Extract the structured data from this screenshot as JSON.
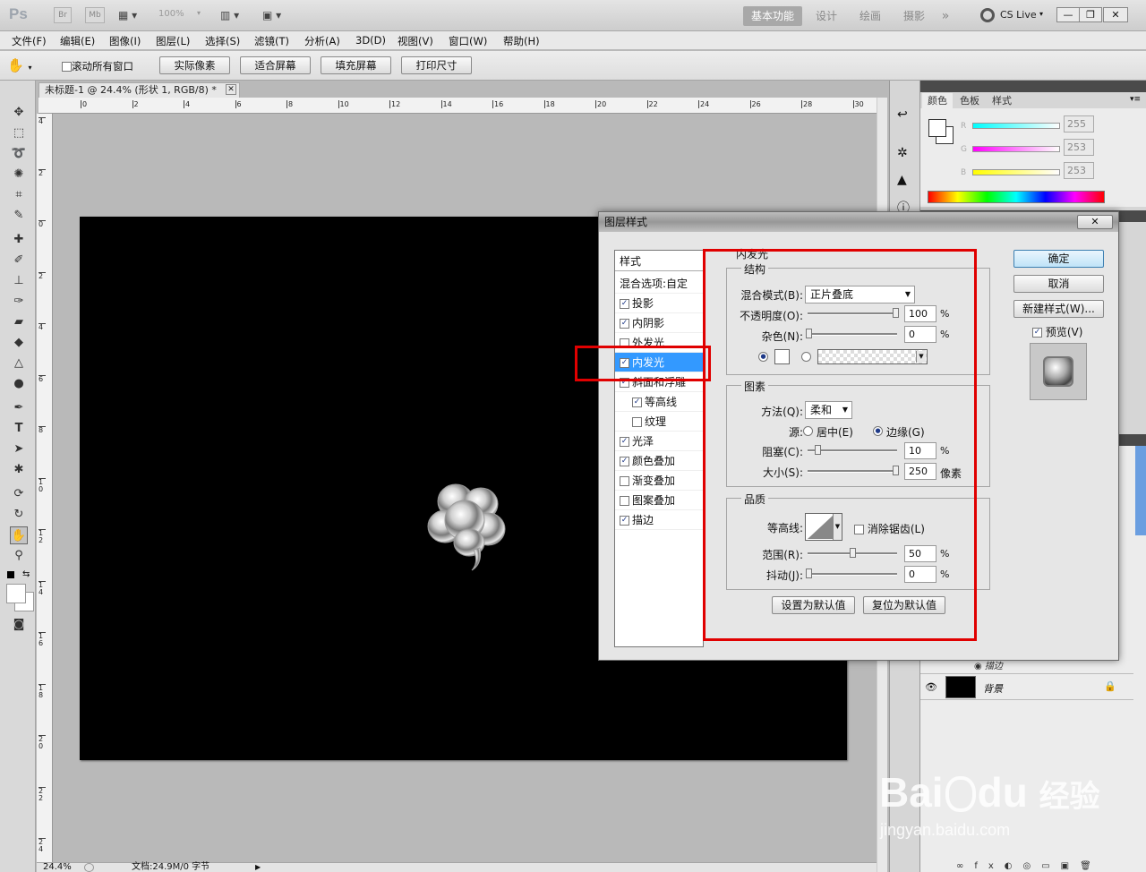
{
  "app": {
    "logo": "Ps",
    "bridge_btn": "Br",
    "minibridge_btn": "Mb",
    "zoom_field": "100%",
    "workspaces": [
      "基本功能",
      "设计",
      "绘画",
      "摄影"
    ],
    "more": "»",
    "cslive": "CS Live"
  },
  "menu": [
    "文件(F)",
    "编辑(E)",
    "图像(I)",
    "图层(L)",
    "选择(S)",
    "滤镜(T)",
    "分析(A)",
    "3D(D)",
    "视图(V)",
    "窗口(W)",
    "帮助(H)"
  ],
  "options": {
    "scroll_all_label": "滚动所有窗口",
    "buttons": [
      "实际像素",
      "适合屏幕",
      "填充屏幕",
      "打印尺寸"
    ]
  },
  "document": {
    "tab_title": "未标题-1 @ 24.4% (形状 1, RGB/8) *",
    "ruler_top": [
      "0",
      "2",
      "4",
      "6",
      "8",
      "10",
      "12",
      "14",
      "16",
      "18",
      "20",
      "22",
      "24",
      "26",
      "28",
      "30"
    ],
    "ruler_left": [
      "4",
      "2",
      "0",
      "2",
      "4",
      "6",
      "8",
      "1 0",
      "1 2",
      "1 4",
      "1 6",
      "1 8",
      "2 0",
      "2 2",
      "2 4"
    ],
    "zoom": "24.4%",
    "doc_info": "文档:24.9M/0 字节"
  },
  "color_panel": {
    "tabs": [
      "颜色",
      "色板",
      "样式"
    ],
    "r_label": "R",
    "g_label": "G",
    "b_label": "B",
    "r": "255",
    "g": "253",
    "b": "253"
  },
  "layers_panel": {
    "effect_label": "描边",
    "bg_layer": "背景"
  },
  "dialog": {
    "title": "图层样式",
    "close": "✕",
    "list_header": "样式",
    "blend_options": "混合选项:自定",
    "items": [
      {
        "label": "投影",
        "checked": true,
        "sub": false
      },
      {
        "label": "内阴影",
        "checked": true,
        "sub": false
      },
      {
        "label": "外发光",
        "checked": false,
        "sub": false
      },
      {
        "label": "内发光",
        "checked": true,
        "sub": false,
        "selected": true
      },
      {
        "label": "斜面和浮雕",
        "checked": true,
        "sub": false
      },
      {
        "label": "等高线",
        "checked": true,
        "sub": true
      },
      {
        "label": "纹理",
        "checked": false,
        "sub": true
      },
      {
        "label": "光泽",
        "checked": true,
        "sub": false
      },
      {
        "label": "颜色叠加",
        "checked": true,
        "sub": false
      },
      {
        "label": "渐变叠加",
        "checked": false,
        "sub": false
      },
      {
        "label": "图案叠加",
        "checked": false,
        "sub": false
      },
      {
        "label": "描边",
        "checked": true,
        "sub": false
      }
    ],
    "section_title": "内发光",
    "structure": {
      "title": "结构",
      "blend_mode_label": "混合模式(B):",
      "blend_mode": "正片叠底",
      "opacity_label": "不透明度(O):",
      "opacity": "100",
      "noise_label": "杂色(N):",
      "noise": "0",
      "pct": "%"
    },
    "elements": {
      "title": "图素",
      "method_label": "方法(Q):",
      "method": "柔和",
      "source_label": "源:",
      "center": "居中(E)",
      "edge": "边缘(G)",
      "choke_label": "阻塞(C):",
      "choke": "10",
      "size_label": "大小(S):",
      "size": "250",
      "size_unit": "像素"
    },
    "quality": {
      "title": "品质",
      "contour_label": "等高线:",
      "antialias": "消除锯齿(L)",
      "range_label": "范围(R):",
      "range": "50",
      "jitter_label": "抖动(J):",
      "jitter": "0"
    },
    "set_default": "设置为默认值",
    "reset_default": "复位为默认值",
    "ok": "确定",
    "cancel": "取消",
    "new_style": "新建样式(W)...",
    "preview": "预览(V)"
  },
  "watermark": {
    "brand": "Bai",
    "brand2": "du",
    "cn": "经验",
    "url": "jingyan.baidu.com"
  },
  "colors": {
    "highlight": "#e00000",
    "selection": "#3399ff"
  }
}
